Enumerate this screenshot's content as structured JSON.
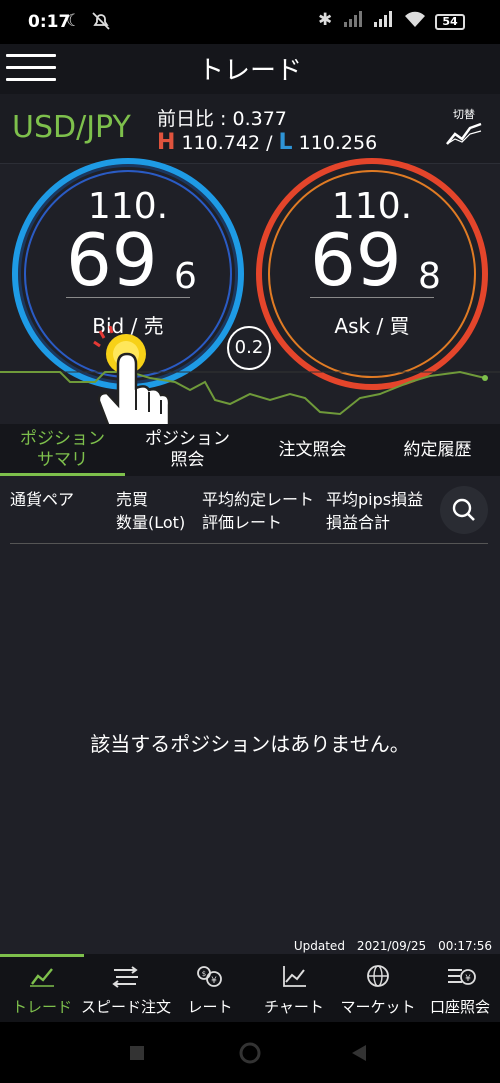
{
  "status_bar": {
    "time": "0:17",
    "battery": "54"
  },
  "header": {
    "title": "トレード"
  },
  "pair": {
    "symbol": "USD/JPY",
    "change": "前日比 : 0.377",
    "high_label": "H",
    "high": "110.742 /",
    "low_label": "L",
    "low": "110.256",
    "switch_label": "切替"
  },
  "bid": {
    "top": "110.",
    "main": "69",
    "last": "6",
    "label": "Bid / 売"
  },
  "ask": {
    "top": "110.",
    "main": "69",
    "last": "8",
    "label": "Ask / 買"
  },
  "spread": "0.2",
  "tabs": [
    {
      "label": "ポジション\nサマリ",
      "active": true
    },
    {
      "label": "ポジション\n照会"
    },
    {
      "label": "注文照会"
    },
    {
      "label": "約定履歴"
    }
  ],
  "columns": {
    "c1": "通貨ペア",
    "c2a": "売買",
    "c2b": "数量(Lot)",
    "c3a": "平均約定レート",
    "c3b": "評価レート",
    "c4a": "平均pips損益",
    "c4b": "損益合計"
  },
  "empty_message": "該当するポジションはありません。",
  "updated": "Updated　2021/09/25　00:17:56",
  "bottom_nav": [
    {
      "label": "トレード",
      "icon": "trend-icon",
      "active": true
    },
    {
      "label": "スピード注文",
      "icon": "speed-order-icon"
    },
    {
      "label": "レート",
      "icon": "rate-icon"
    },
    {
      "label": "チャート",
      "icon": "chart-icon"
    },
    {
      "label": "マーケット",
      "icon": "globe-icon"
    },
    {
      "label": "口座照会",
      "icon": "account-icon"
    }
  ],
  "colors": {
    "accent": "#7ec04c",
    "bid": "#1e9be6",
    "ask": "#e4452b"
  }
}
